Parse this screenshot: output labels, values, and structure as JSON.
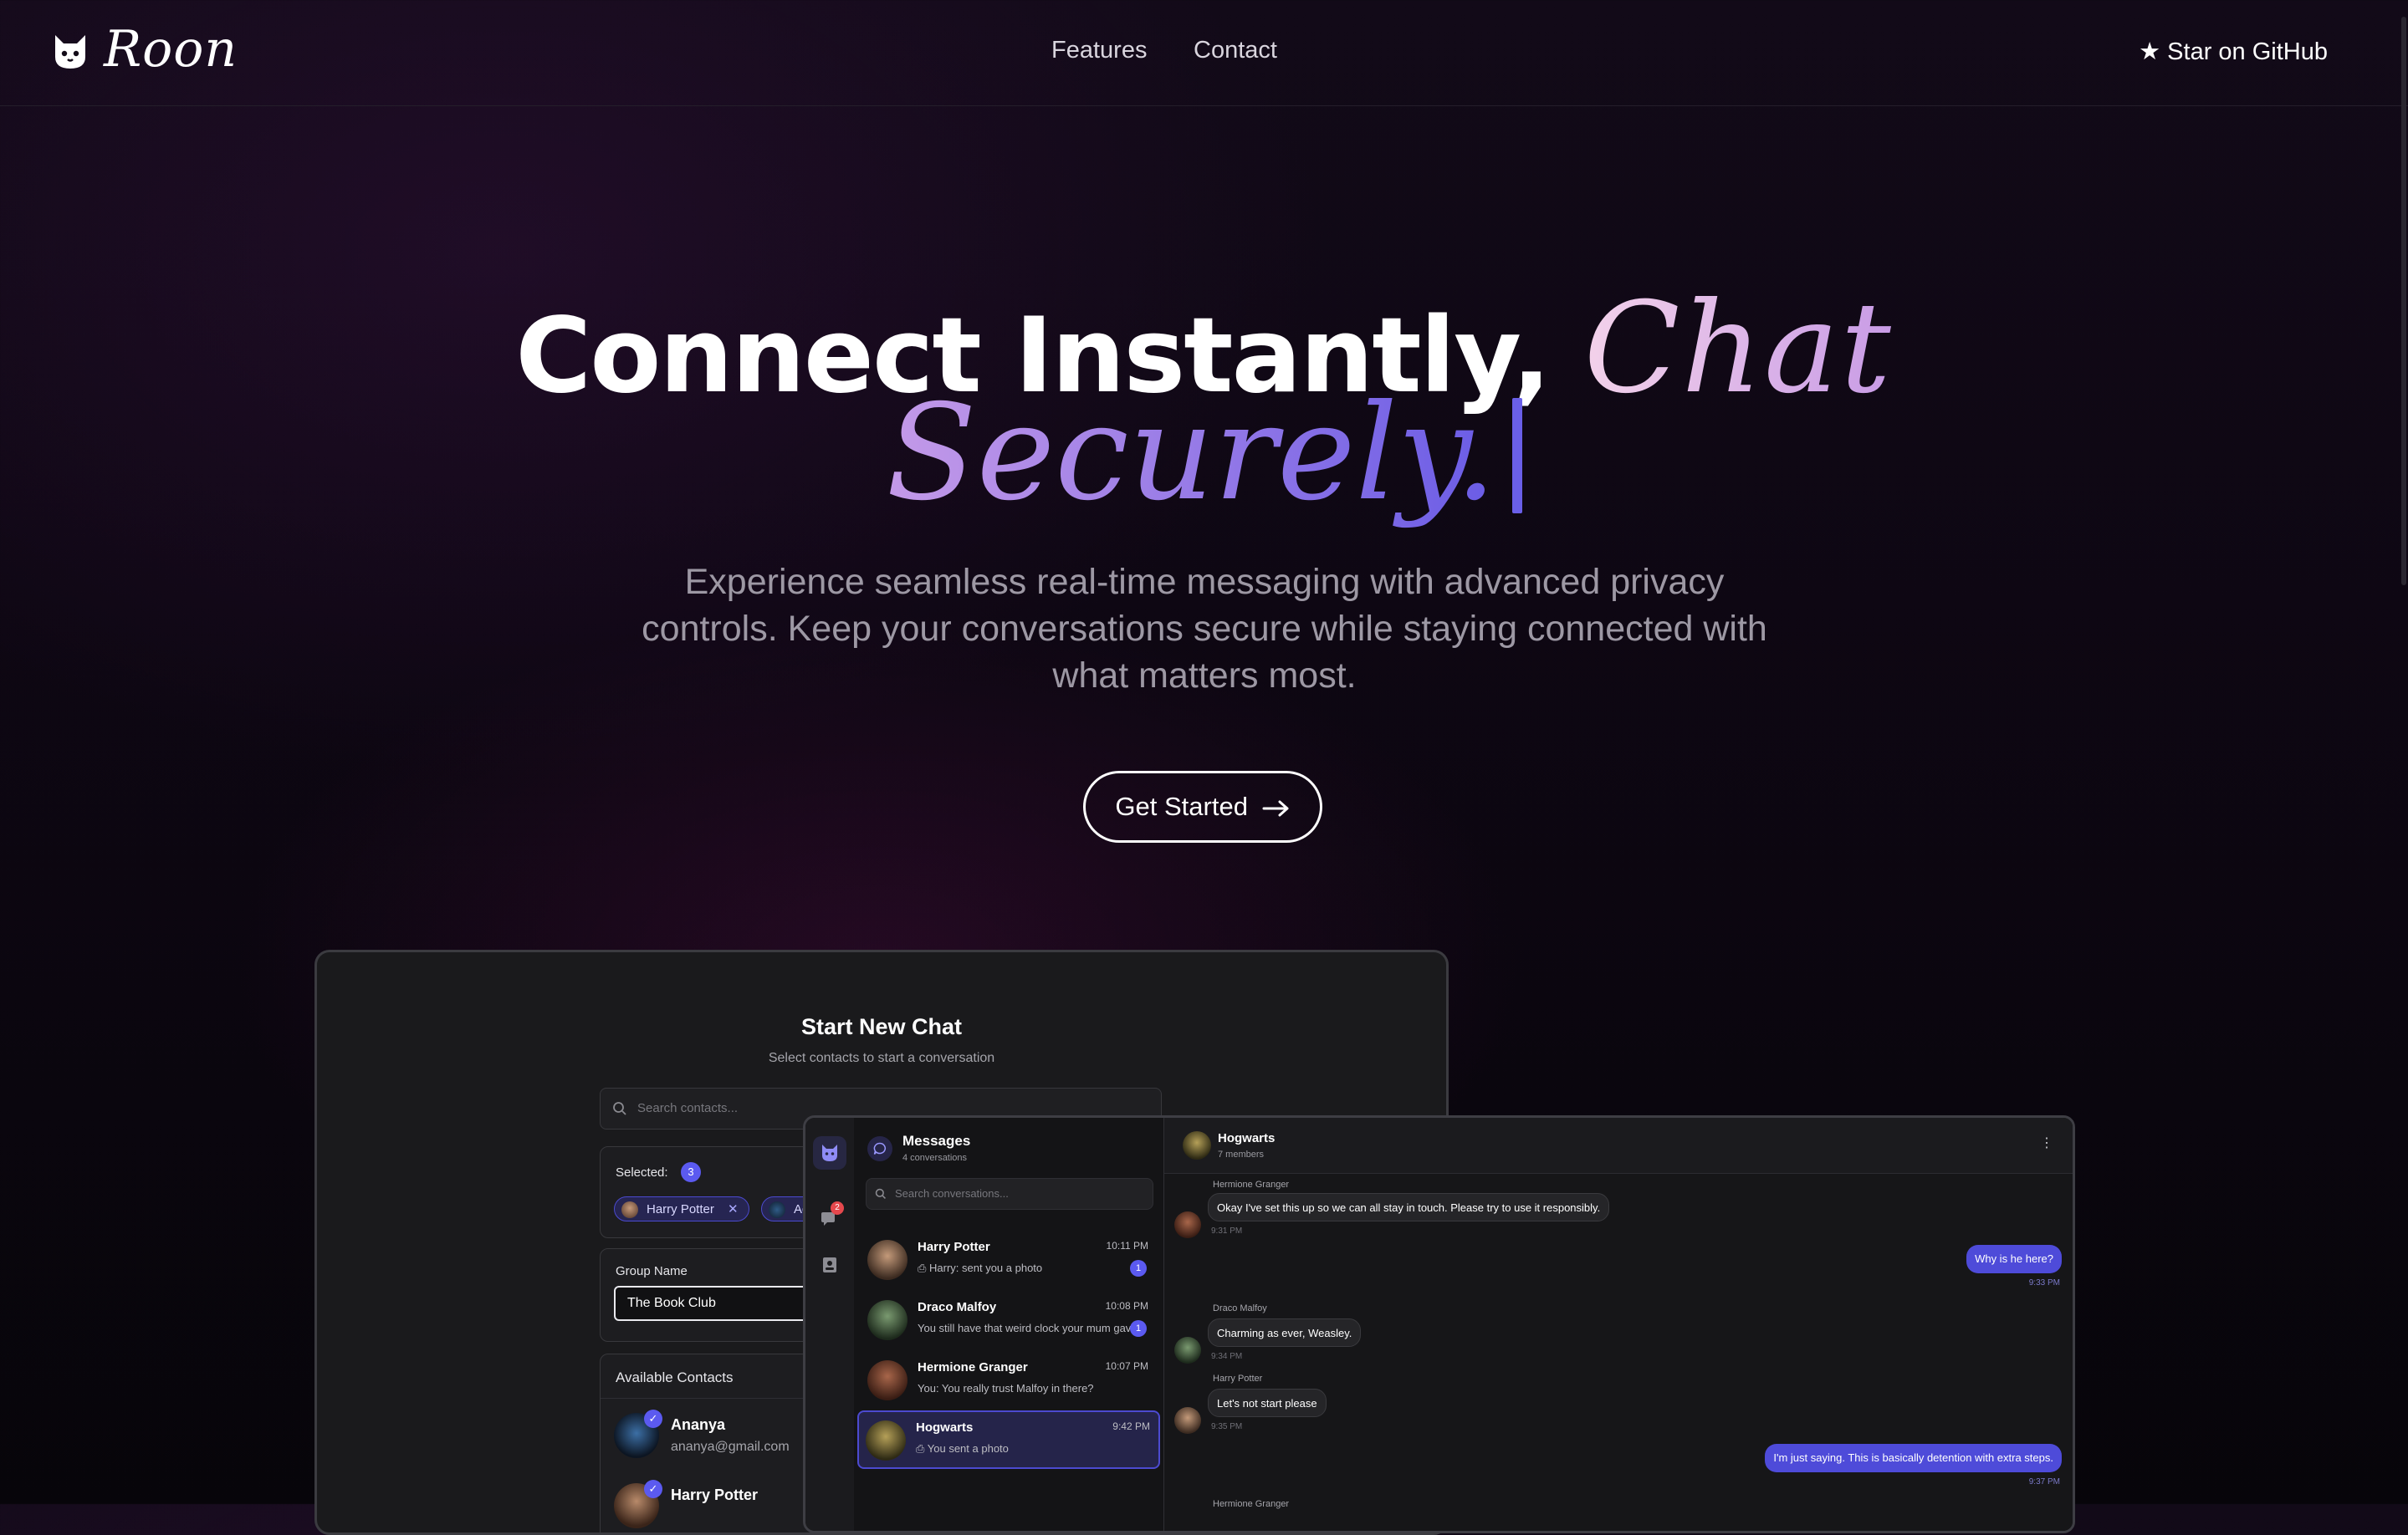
{
  "nav": {
    "brand": "Roon",
    "links": [
      "Features",
      "Contact"
    ],
    "github": "★ Star on GitHub"
  },
  "hero": {
    "title_plain": "Connect Instantly, ",
    "title_script_1": "Chat",
    "title_script_2": "Securely.",
    "subtitle": "Experience seamless real-time messaging with advanced privacy controls. Keep your conversations secure while staying connected with what matters most.",
    "cta": "Get Started"
  },
  "new_chat": {
    "title": "Start New Chat",
    "subtitle": "Select contacts to start a conversation",
    "search_placeholder": "Search contacts...",
    "selected_label": "Selected:",
    "selected_count": "3",
    "chips": [
      "Harry Potter",
      "Ad"
    ],
    "group_name_label": "Group Name",
    "group_name_value": "The Book Club",
    "available_label": "Available Contacts",
    "contacts": [
      {
        "name": "Ananya",
        "email": "ananya@gmail.com"
      },
      {
        "name": "Harry Potter",
        "email": ""
      }
    ]
  },
  "messages": {
    "title": "Messages",
    "count": "4 conversations",
    "search_placeholder": "Search conversations...",
    "rail_badge": "2",
    "conversations": [
      {
        "name": "Harry Potter",
        "preview": "Harry: sent you a photo",
        "time": "10:11 PM",
        "unread": "1"
      },
      {
        "name": "Draco Malfoy",
        "preview": "You still have that weird clock your mum gave",
        "time": "10:08 PM",
        "unread": "1"
      },
      {
        "name": "Hermione Granger",
        "preview": "You: You really trust Malfoy in there?",
        "time": "10:07 PM",
        "unread": ""
      },
      {
        "name": "Hogwarts",
        "preview": "You sent a photo",
        "time": "9:42 PM",
        "unread": ""
      }
    ]
  },
  "chat": {
    "name": "Hogwarts",
    "members": "7 members",
    "messages": [
      {
        "sender": "Hermione Granger",
        "text": "Okay I've set this up so we can all stay in touch. Please try to use it responsibly.",
        "time": "9:31 PM",
        "dir": "in"
      },
      {
        "sender": "",
        "text": "Why is he here?",
        "time": "9:33 PM",
        "dir": "out"
      },
      {
        "sender": "Draco Malfoy",
        "text": "Charming as ever, Weasley.",
        "time": "9:34 PM",
        "dir": "in"
      },
      {
        "sender": "Harry Potter",
        "text": "Let's not start please",
        "time": "9:35 PM",
        "dir": "in"
      },
      {
        "sender": "",
        "text": "I'm just saying. This is basically detention with extra steps.",
        "time": "9:37 PM",
        "dir": "out"
      },
      {
        "sender": "Hermione Granger",
        "text": "",
        "time": "",
        "dir": "in"
      }
    ]
  }
}
